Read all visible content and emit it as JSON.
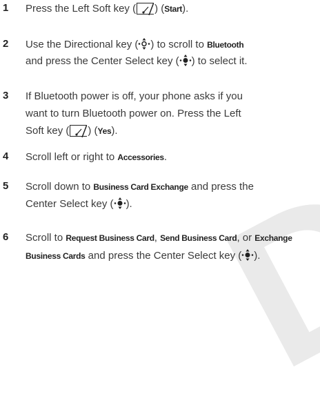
{
  "watermark": "DRAFT",
  "steps": [
    {
      "num": "1",
      "line1": {
        "t1": "Press the Left Soft key (",
        "t2": ") ",
        "t3": "(",
        "term": "Start",
        "t4": ")."
      }
    },
    {
      "num": "2",
      "line1": {
        "t1": "Use the Directional key (",
        "t2": ") to scroll to ",
        "term": "Bluetooth"
      },
      "line2": {
        "t1": "and press the Center Select key (",
        "t2": ") to select it."
      }
    },
    {
      "num": "3",
      "line1": "If Bluetooth power is off, your phone asks if you",
      "line2": "want to turn Bluetooth power on. Press the Left",
      "line3": {
        "t1": "Soft key (",
        "t2": ") (",
        "term": "Yes",
        "t3": ")."
      }
    },
    {
      "num": "4",
      "line1": {
        "t1": "Scroll left or right to ",
        "term": "Accessories",
        "t2": "."
      }
    },
    {
      "num": "5",
      "line1": {
        "t1": "Scroll down to ",
        "term": "Business Card Exchange",
        "t2": " and press the"
      },
      "line2": {
        "t1": "Center Select key (",
        "t2": ")."
      }
    },
    {
      "num": "6",
      "line1": {
        "t1": "Scroll to ",
        "term1": "Request Business Card",
        "t2": ", ",
        "term2": "Send Business Card",
        "t3": ", or ",
        "term3": "Exchange"
      },
      "line2": {
        "term": "Business Cards",
        "t1": " and press the Center Select key (",
        "t2": ")."
      }
    }
  ]
}
